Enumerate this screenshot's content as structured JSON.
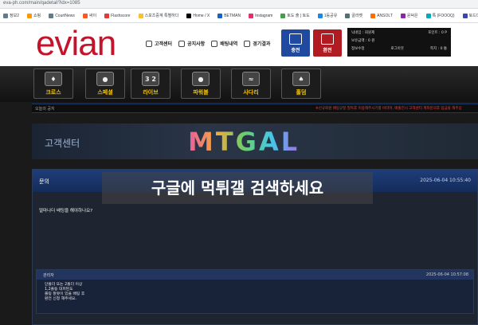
{
  "browser": {
    "url": "eva-ph.com/main/qadetail?idx=1085",
    "bookmarks": [
      {
        "label": "정보2",
        "color": "#607d8b"
      },
      {
        "label": "쇼핑",
        "color": "#ff9800"
      },
      {
        "label": "CourtNews",
        "color": "#607d8b"
      },
      {
        "label": "싸이",
        "color": "#ff5722"
      },
      {
        "label": "Flashscore",
        "color": "#e53935"
      },
      {
        "label": "스포츠중계 특별하다",
        "color": "#fbc02d"
      },
      {
        "label": "Home / X",
        "color": "#000000"
      },
      {
        "label": "BETMAN",
        "color": "#1565c0"
      },
      {
        "label": "Instagram",
        "color": "#e1306c"
      },
      {
        "label": "토도 출 | 토도",
        "color": "#43a047"
      },
      {
        "label": "1등공유",
        "color": "#1e88e5"
      },
      {
        "label": "골라켓",
        "color": "#546e7a"
      },
      {
        "label": "ANSOLT",
        "color": "#ff6f00"
      },
      {
        "label": "윤덕은",
        "color": "#8e24aa"
      },
      {
        "label": "톡 (FOOOQ)",
        "color": "#00acc1"
      },
      {
        "label": "토드디드",
        "color": "#3949ab"
      }
    ]
  },
  "header": {
    "logo": "evian",
    "nav": [
      "고객센터",
      "공지사항",
      "배팅내역",
      "경기결과"
    ],
    "deposit_label": "충전",
    "withdraw_label": "환전",
    "user": {
      "nickname_label": "닉네임 :",
      "nickname_value": "회원제",
      "point_label": "포인트 : 0 P",
      "balance_label": "보유금액 : 0 원",
      "info_label": "정보수정",
      "logout_label": "로그아웃",
      "message_label": "쪽지 : 0 통"
    }
  },
  "menu": [
    {
      "label": "크로스",
      "icon": "medal-icon",
      "glyph": "♦"
    },
    {
      "label": "스페셜",
      "icon": "ball-icon",
      "glyph": "●"
    },
    {
      "label": "라이브",
      "icon": "scoreboard-icon",
      "glyph": "3 2"
    },
    {
      "label": "파워볼",
      "icon": "powerball-icon",
      "glyph": "●"
    },
    {
      "label": "사다리",
      "icon": "ladder-icon",
      "glyph": "≈"
    },
    {
      "label": "홀덤",
      "icon": "cards-icon",
      "glyph": "♠"
    }
  ],
  "notice": {
    "label": "오늘의 공지",
    "text": "※신규회원 배팅규정 필독후 이용해주시기를 바라며, 배출전시 고객센터 계좌문의후 입금을 해주십"
  },
  "banner": {
    "title": "고객센터",
    "brand": "MTGAL"
  },
  "post": {
    "category": "문의",
    "date": "2025-06-04 10:55:40",
    "overlay": "구글에 먹튀갤 검색하세요",
    "question": "얼마나더 배팅을 해야하나요?",
    "reply": {
      "author": "관리자",
      "date": "2025-06-04 10:57:08",
      "lines": [
        "단폴더 또는 2폴더 이상",
        "1,2폴동 대피된도",
        "롤링 잘못이 있을 배팅 후",
        "환전 신청 해주세요."
      ]
    }
  },
  "colors": {
    "brand_red": "#c3142b",
    "deposit_blue": "#1f4aa0",
    "withdraw_red": "#b01c22",
    "menu_yellow": "#f5c400"
  }
}
